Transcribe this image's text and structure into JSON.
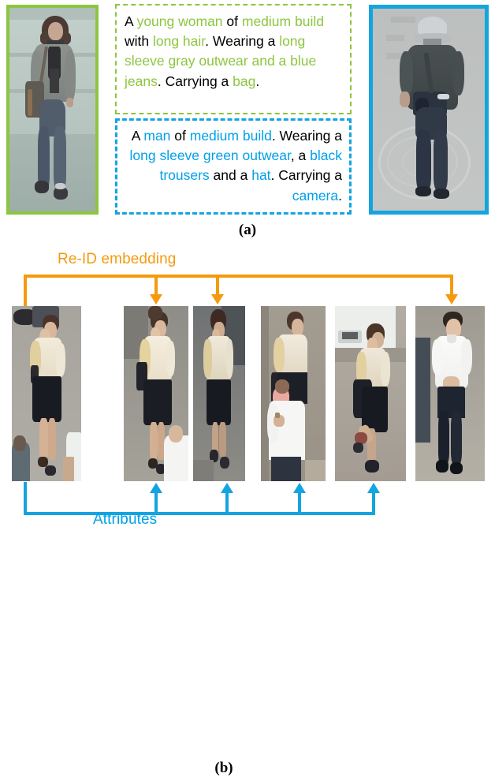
{
  "figure_a": {
    "label": "(a)",
    "left_photo": {
      "name": "pedestrian-photo-woman",
      "border_color": "#8cc63f",
      "alt": "surveillance photo of a young woman in gray outwear and blue jeans carrying a bag"
    },
    "right_photo": {
      "name": "pedestrian-photo-man",
      "border_color": "#14a4e0",
      "alt": "surveillance photo of a man in green outwear, black trousers and a hat carrying a camera"
    },
    "caption_green": {
      "border_color": "#8cc63f",
      "highlight_color": "#8cc63f",
      "segments": [
        {
          "t": "A ",
          "c": "black"
        },
        {
          "t": "young woman",
          "c": "green"
        },
        {
          "t": " of ",
          "c": "black"
        },
        {
          "t": "medium build",
          "c": "green"
        },
        {
          "t": " with ",
          "c": "black"
        },
        {
          "t": "long hair",
          "c": "green"
        },
        {
          "t": ". Wearing a ",
          "c": "black"
        },
        {
          "t": "long sleeve gray outwear and a blue jeans",
          "c": "green"
        },
        {
          "t": ". Carrying a ",
          "c": "black"
        },
        {
          "t": "bag",
          "c": "green"
        },
        {
          "t": ".",
          "c": "black"
        }
      ]
    },
    "caption_blue": {
      "border_color": "#14a4e0",
      "highlight_color": "#00a0e9",
      "segments": [
        {
          "t": "A ",
          "c": "black"
        },
        {
          "t": "man",
          "c": "blue"
        },
        {
          "t": " of ",
          "c": "black"
        },
        {
          "t": "medium build",
          "c": "blue"
        },
        {
          "t": ". Wearing a ",
          "c": "black"
        },
        {
          "t": "long sleeve green outwear",
          "c": "blue"
        },
        {
          "t": ", a ",
          "c": "black"
        },
        {
          "t": "black trousers",
          "c": "blue"
        },
        {
          "t": " and a ",
          "c": "black"
        },
        {
          "t": "hat",
          "c": "blue"
        },
        {
          "t": ". Carrying a ",
          "c": "black"
        },
        {
          "t": "camera",
          "c": "blue"
        },
        {
          "t": ".",
          "c": "black"
        }
      ]
    }
  },
  "figure_b": {
    "label": "(b)",
    "reid_label": "Re-ID embedding",
    "reid_color": "#f59a0e",
    "attributes_label": "Attributes",
    "attributes_color": "#00a0e9",
    "gallery": [
      {
        "name": "query-image",
        "role": "query",
        "reid_match": false,
        "attribute_match": false,
        "alt": "woman in cream blouse and black skirt walking, hand to face"
      },
      {
        "name": "gallery-image-1",
        "role": "gallery",
        "reid_match": true,
        "attribute_match": true,
        "alt": "same woman in cream blouse and black skirt, man in white shirt behind"
      },
      {
        "name": "gallery-image-2",
        "role": "gallery",
        "reid_match": true,
        "attribute_match": true,
        "alt": "same woman in cream blouse and black skirt, darker scene"
      },
      {
        "name": "gallery-image-3",
        "role": "gallery",
        "reid_match": false,
        "attribute_match": true,
        "alt": "woman in cream top with man in white t-shirt in foreground"
      },
      {
        "name": "gallery-image-4",
        "role": "gallery",
        "reid_match": false,
        "attribute_match": true,
        "alt": "woman in cream top and black skirt with black bag, white car behind"
      },
      {
        "name": "gallery-image-5",
        "role": "gallery",
        "reid_match": true,
        "attribute_match": false,
        "alt": "man in white polo shirt and dark trousers walking"
      }
    ]
  }
}
